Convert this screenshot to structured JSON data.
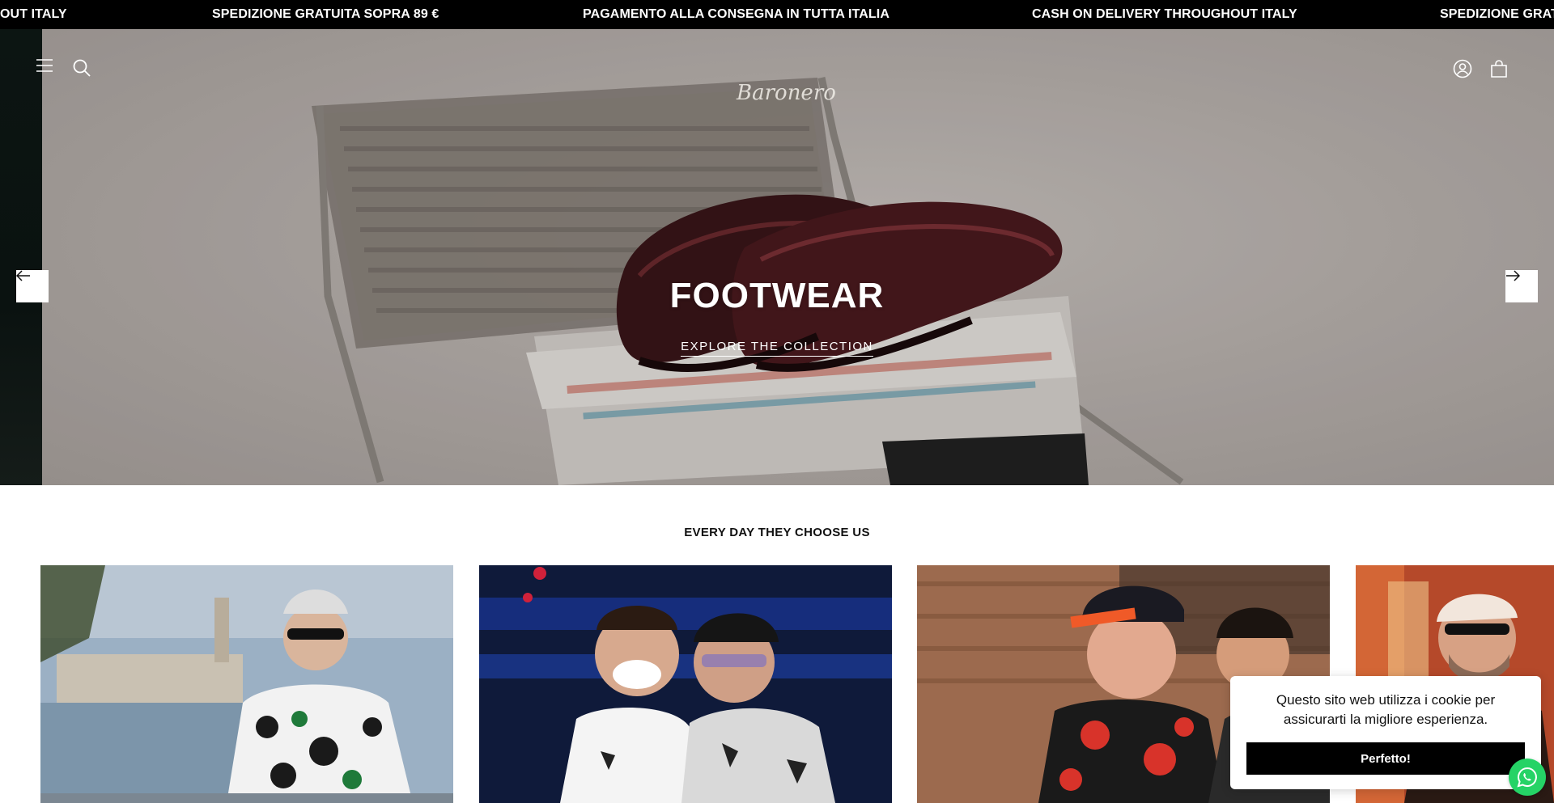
{
  "announcement": {
    "messages": [
      "OUT ITALY",
      "SPEDIZIONE GRATUITA SOPRA 89 €",
      "PAGAMENTO ALLA CONSEGNA IN TUTTA ITALIA",
      "CASH ON DELIVERY THROUGHOUT ITALY",
      "SPEDIZIONE GRAT"
    ]
  },
  "header": {
    "logo_text": "Baronero",
    "icons": [
      "menu-icon",
      "search-icon",
      "account-icon",
      "cart-icon"
    ]
  },
  "hero": {
    "title": "FOOTWEAR",
    "link_label": "EXPLORE THE COLLECTION"
  },
  "section": {
    "title": "EVERY DAY THEY CHOOSE US"
  },
  "cookie": {
    "text": "Questo sito web utilizza i cookie per assicurarti la migliore esperienza.",
    "button_label": "Perfetto!"
  },
  "colors": {
    "announcement_bg": "#000000",
    "whatsapp": "#25d366",
    "button_bg": "#000000"
  }
}
